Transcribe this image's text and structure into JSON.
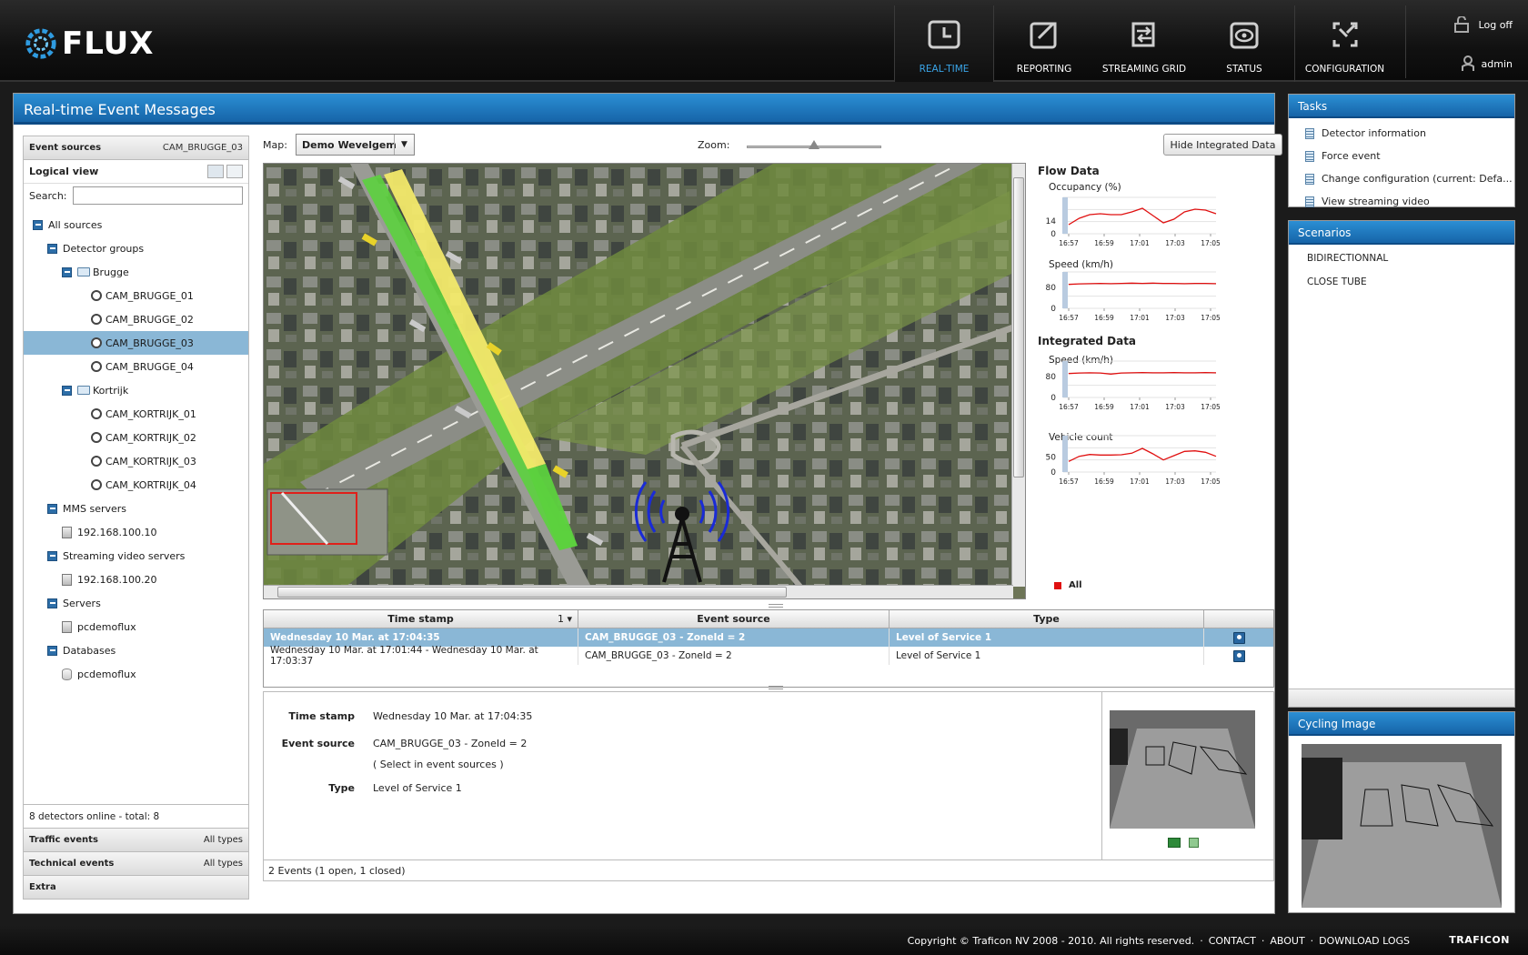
{
  "app": {
    "brand": "FLUX",
    "nav": [
      {
        "label": "REAL-TIME",
        "icon": "clock-icon",
        "active": true
      },
      {
        "label": "REPORTING",
        "icon": "export-icon",
        "active": false
      },
      {
        "label": "STREAMING GRID",
        "icon": "arrows-icon",
        "active": false
      },
      {
        "label": "STATUS",
        "icon": "eye-icon",
        "active": false
      },
      {
        "label": "CONFIGURATION",
        "icon": "compress-icon",
        "active": false
      }
    ],
    "logoff_label": "Log off",
    "username": "admin"
  },
  "main": {
    "title": "Real-time Event Messages"
  },
  "sources": {
    "header_label": "Event sources",
    "header_value": "CAM_BRUGGE_03",
    "view_label": "Logical view",
    "search_label": "Search:",
    "search_value": "",
    "tree": [
      {
        "label": "All sources",
        "level": 0,
        "type": "toggle"
      },
      {
        "label": "Detector groups",
        "level": 1,
        "type": "toggle"
      },
      {
        "label": "Brugge",
        "level": 2,
        "type": "folder"
      },
      {
        "label": "CAM_BRUGGE_01",
        "level": 3,
        "type": "cam"
      },
      {
        "label": "CAM_BRUGGE_02",
        "level": 3,
        "type": "cam"
      },
      {
        "label": "CAM_BRUGGE_03",
        "level": 3,
        "type": "cam",
        "selected": true
      },
      {
        "label": "CAM_BRUGGE_04",
        "level": 3,
        "type": "cam"
      },
      {
        "label": "Kortrijk",
        "level": 2,
        "type": "folder"
      },
      {
        "label": "CAM_KORTRIJK_01",
        "level": 3,
        "type": "cam"
      },
      {
        "label": "CAM_KORTRIJK_02",
        "level": 3,
        "type": "cam"
      },
      {
        "label": "CAM_KORTRIJK_03",
        "level": 3,
        "type": "cam"
      },
      {
        "label": "CAM_KORTRIJK_04",
        "level": 3,
        "type": "cam"
      },
      {
        "label": "MMS servers",
        "level": 1,
        "type": "toggle"
      },
      {
        "label": "192.168.100.10",
        "level": 2,
        "type": "srv"
      },
      {
        "label": "Streaming video servers",
        "level": 1,
        "type": "toggle"
      },
      {
        "label": "192.168.100.20",
        "level": 2,
        "type": "srv"
      },
      {
        "label": "Servers",
        "level": 1,
        "type": "toggle"
      },
      {
        "label": "pcdemoflux",
        "level": 2,
        "type": "srv"
      },
      {
        "label": "Databases",
        "level": 1,
        "type": "toggle"
      },
      {
        "label": "pcdemoflux",
        "level": 2,
        "type": "db"
      }
    ],
    "status": "8 detectors online - total: 8",
    "traffic_events_label": "Traffic events",
    "traffic_events_value": "All types",
    "technical_events_label": "Technical events",
    "technical_events_value": "All types",
    "extra_label": "Extra"
  },
  "map": {
    "label": "Map:",
    "selected": "Demo Wevelgem",
    "zoom_label": "Zoom:",
    "zoom_level": 0.55,
    "hide_button": "Hide Integrated Data"
  },
  "charts": {
    "flow_title": "Flow Data",
    "integrated_title": "Integrated Data",
    "legend": "All",
    "line_color": "#e01010"
  },
  "chart_data": [
    {
      "type": "line",
      "title": "Occupancy (%)",
      "x": [
        "16:57",
        "16:59",
        "17:01",
        "17:03",
        "17:05"
      ],
      "yticks": [
        0,
        14
      ],
      "series": [
        {
          "name": "All",
          "values": [
            10,
            17,
            21,
            22,
            21,
            21,
            24,
            28,
            20,
            12,
            16,
            24,
            27,
            26,
            22
          ]
        }
      ],
      "ylim": [
        0,
        40
      ]
    },
    {
      "type": "line",
      "title": "Speed (km/h)",
      "x": [
        "16:57",
        "16:59",
        "17:01",
        "17:03",
        "17:05"
      ],
      "yticks": [
        0,
        80
      ],
      "series": [
        {
          "name": "All",
          "values": [
            92,
            94,
            95,
            96,
            95,
            96,
            97,
            96,
            97,
            96,
            96,
            95,
            96,
            96,
            95
          ]
        }
      ],
      "ylim": [
        0,
        140
      ]
    },
    {
      "type": "line",
      "title": "Speed (km/h)",
      "x": [
        "16:57",
        "16:59",
        "17:01",
        "17:03",
        "17:05"
      ],
      "yticks": [
        0,
        80
      ],
      "series": [
        {
          "name": "All",
          "values": [
            92,
            94,
            95,
            94,
            90,
            94,
            95,
            96,
            95,
            95,
            96,
            95,
            95,
            96,
            95
          ]
        }
      ],
      "ylim": [
        0,
        140
      ]
    },
    {
      "type": "line",
      "title": "Vehicle count",
      "x": [
        "16:57",
        "16:59",
        "17:01",
        "17:03",
        "17:05"
      ],
      "yticks": [
        0,
        50
      ],
      "series": [
        {
          "name": "All",
          "values": [
            35,
            52,
            58,
            56,
            56,
            57,
            62,
            78,
            60,
            40,
            54,
            68,
            70,
            65,
            52
          ]
        }
      ],
      "ylim": [
        0,
        120
      ]
    }
  ],
  "events": {
    "columns": [
      "Time stamp",
      "Event source",
      "Type"
    ],
    "sort_indicator": "1",
    "rows": [
      {
        "time": "Wednesday 10 Mar. at 17:04:35",
        "source": "CAM_BRUGGE_03 - ZoneId = 2",
        "type": "Level of Service 1",
        "selected": true
      },
      {
        "time": "Wednesday 10 Mar. at 17:01:44 - Wednesday 10 Mar. at 17:03:37",
        "source": "CAM_BRUGGE_03 - ZoneId = 2",
        "type": "Level of Service 1",
        "selected": false
      }
    ],
    "summary": "2 Events (1 open, 1 closed)"
  },
  "detail": {
    "time_label": "Time stamp",
    "time_value": "Wednesday 10 Mar. at 17:04:35",
    "source_label": "Event source",
    "source_value": "CAM_BRUGGE_03 - ZoneId = 2",
    "select_link": "( Select in event sources )",
    "type_label": "Type",
    "type_value": "Level of Service 1"
  },
  "tasks": {
    "title": "Tasks",
    "items": [
      "Detector information",
      "Force event",
      "Change configuration (current: Defa...",
      "View streaming video"
    ]
  },
  "scenarios": {
    "title": "Scenarios",
    "items": [
      "BIDIRECTIONNAL",
      "CLOSE TUBE"
    ]
  },
  "cycling": {
    "title": "Cycling Image"
  },
  "footer": {
    "copyright": "Copyright © Traficon NV 2008 - 2010. All rights reserved.",
    "links": [
      "CONTACT",
      "ABOUT",
      "DOWNLOAD LOGS"
    ],
    "company": "TRAFICON"
  }
}
